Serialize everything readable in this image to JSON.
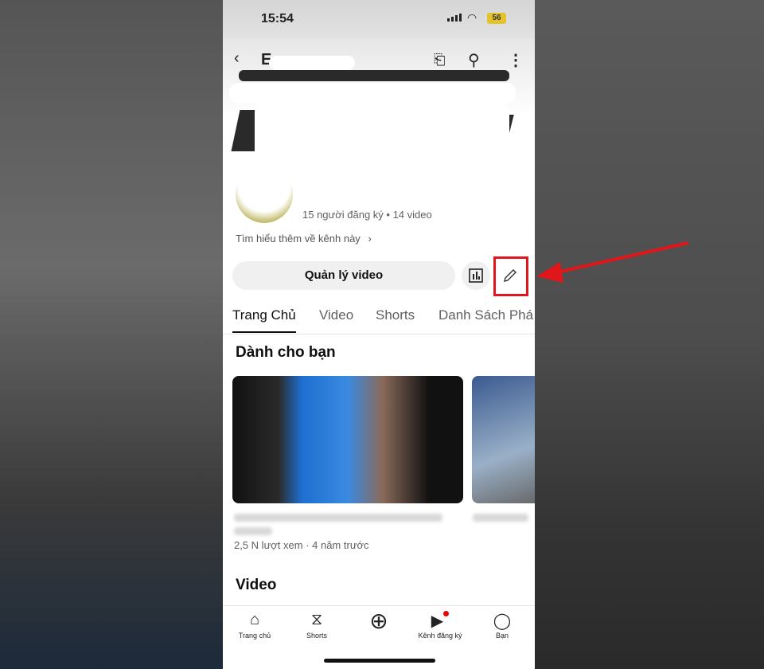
{
  "status_bar": {
    "time": "15:54",
    "battery": "56"
  },
  "header": {
    "back_icon": "chevron-left-icon",
    "cast_icon": "cast-icon",
    "search_icon": "search-icon",
    "more_icon": "more-vertical-icon"
  },
  "channel": {
    "stats": "15 người đăng ký • 14 video",
    "learn_more": "Tìm hiểu thêm về kênh này"
  },
  "actions": {
    "manage_label": "Quản lý video",
    "analytics_icon": "bar-chart-icon",
    "edit_icon": "pencil-icon"
  },
  "tabs": [
    {
      "label": "Trang Chủ",
      "active": true
    },
    {
      "label": "Video"
    },
    {
      "label": "Shorts"
    },
    {
      "label": "Danh Sách Phá"
    }
  ],
  "sections": {
    "for_you": "Dành cho bạn",
    "video": "Video"
  },
  "videos": [
    {
      "meta": "2,5 N lượt xem · 4 năm trước"
    }
  ],
  "bottom_nav": [
    {
      "label": "Trang chủ",
      "icon": "home-icon"
    },
    {
      "label": "Shorts",
      "icon": "shorts-icon"
    },
    {
      "label": "",
      "icon": "plus-circle-icon"
    },
    {
      "label": "Kênh đăng ký",
      "icon": "subscriptions-icon"
    },
    {
      "label": "Bạn",
      "icon": "avatar-icon"
    }
  ],
  "annotation": {
    "color": "#e0161b"
  }
}
